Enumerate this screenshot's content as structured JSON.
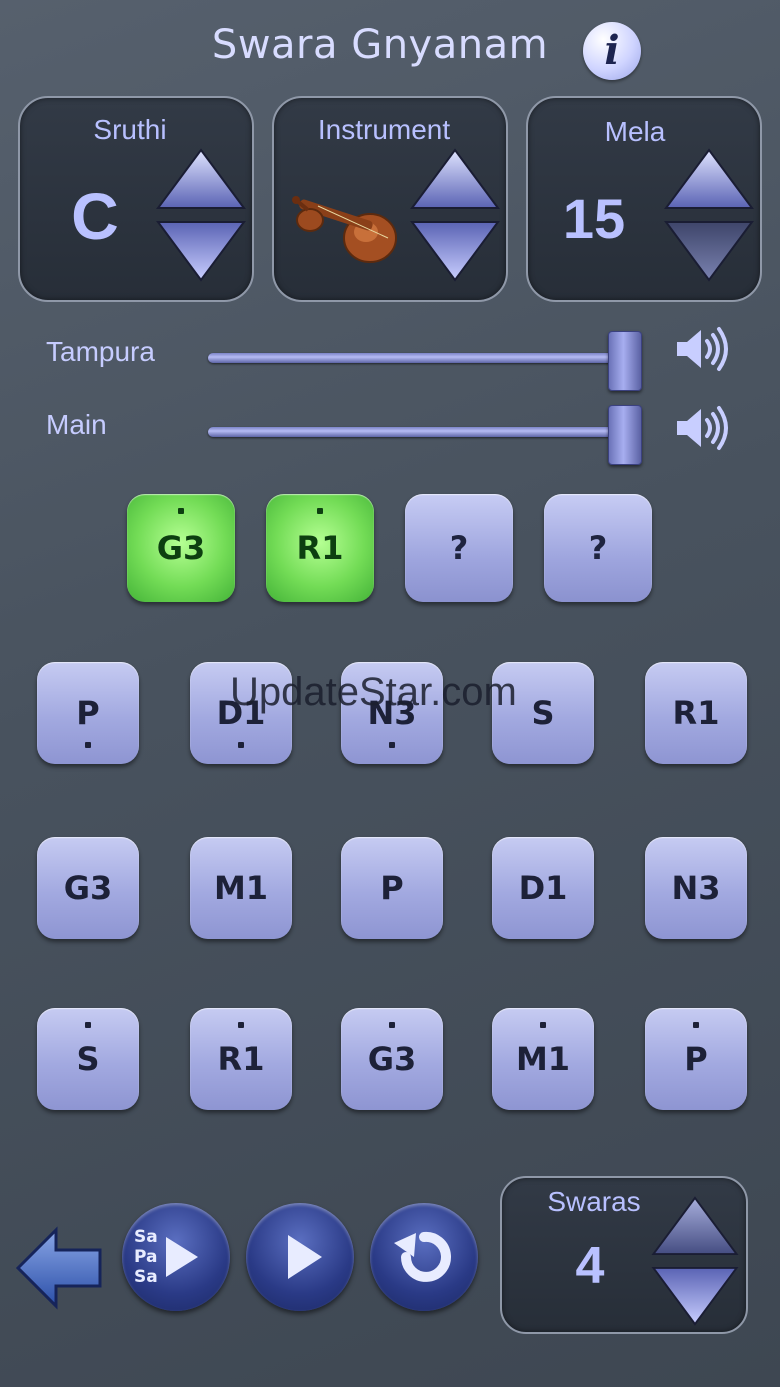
{
  "header": {
    "title": "Swara Gnyanam",
    "info_glyph": "i"
  },
  "sruthi": {
    "label": "Sruthi",
    "value": "C"
  },
  "instrument": {
    "label": "Instrument",
    "icon": "veena-icon"
  },
  "mela": {
    "label": "Mela",
    "value": "15"
  },
  "volume": {
    "tampura": {
      "label": "Tampura",
      "level": 1.0
    },
    "main": {
      "label": "Main",
      "level": 1.0
    }
  },
  "answers": [
    {
      "label": "G3",
      "dot": "top",
      "state": "correct"
    },
    {
      "label": "R1",
      "dot": "top",
      "state": "correct"
    },
    {
      "label": "?",
      "dot": "none",
      "state": "unknown"
    },
    {
      "label": "?",
      "dot": "none",
      "state": "unknown"
    }
  ],
  "keyboard": {
    "rows": [
      [
        {
          "label": "P",
          "dot": "bottom"
        },
        {
          "label": "D1",
          "dot": "bottom"
        },
        {
          "label": "N3",
          "dot": "bottom"
        },
        {
          "label": "S",
          "dot": "none"
        },
        {
          "label": "R1",
          "dot": "none"
        }
      ],
      [
        {
          "label": "G3",
          "dot": "none"
        },
        {
          "label": "M1",
          "dot": "none"
        },
        {
          "label": "P",
          "dot": "none"
        },
        {
          "label": "D1",
          "dot": "none"
        },
        {
          "label": "N3",
          "dot": "none"
        }
      ],
      [
        {
          "label": "S",
          "dot": "top"
        },
        {
          "label": "R1",
          "dot": "top"
        },
        {
          "label": "G3",
          "dot": "top"
        },
        {
          "label": "M1",
          "dot": "top"
        },
        {
          "label": "P",
          "dot": "top"
        }
      ]
    ]
  },
  "watermark": "UpdateStar.com",
  "controls": {
    "sapasa_lines": [
      "Sa",
      "Pa",
      "Sa"
    ]
  },
  "swaras": {
    "label": "Swaras",
    "value": "4"
  },
  "colors": {
    "accent": "#a2a9e0",
    "correct": "#73dc56",
    "panel": "#2b323d"
  }
}
